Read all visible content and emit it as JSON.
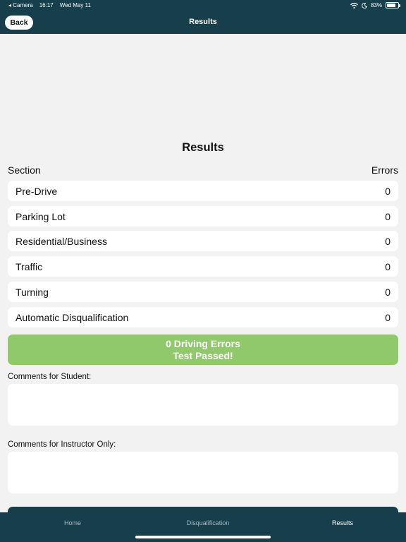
{
  "status_bar": {
    "back_app": "◂ Camera",
    "time": "16:17",
    "date": "Wed May 11",
    "battery_text": "83%",
    "battery_level": 0.83
  },
  "nav": {
    "back_label": "Back",
    "title": "Results"
  },
  "results": {
    "title": "Results",
    "section_header": "Section",
    "errors_header": "Errors",
    "rows": [
      {
        "section": "Pre-Drive",
        "errors": "0"
      },
      {
        "section": "Parking Lot",
        "errors": "0"
      },
      {
        "section": "Residential/Business",
        "errors": "0"
      },
      {
        "section": "Traffic",
        "errors": "0"
      },
      {
        "section": "Turning",
        "errors": "0"
      },
      {
        "section": "Automatic Disqualification",
        "errors": "0"
      }
    ],
    "summary_line1": "0 Driving Errors",
    "summary_line2": "Test Passed!",
    "summary_color": "#8fc96b"
  },
  "comments": {
    "student_label": "Comments for Student:",
    "student_value": "",
    "instructor_label": "Comments for Instructor Only:",
    "instructor_value": ""
  },
  "tabs": [
    {
      "label": "Home",
      "active": false
    },
    {
      "label": "Disqualification",
      "active": false
    },
    {
      "label": "Results",
      "active": true
    }
  ],
  "theme": {
    "primary": "#163e4b",
    "background": "#f2f2f2"
  }
}
